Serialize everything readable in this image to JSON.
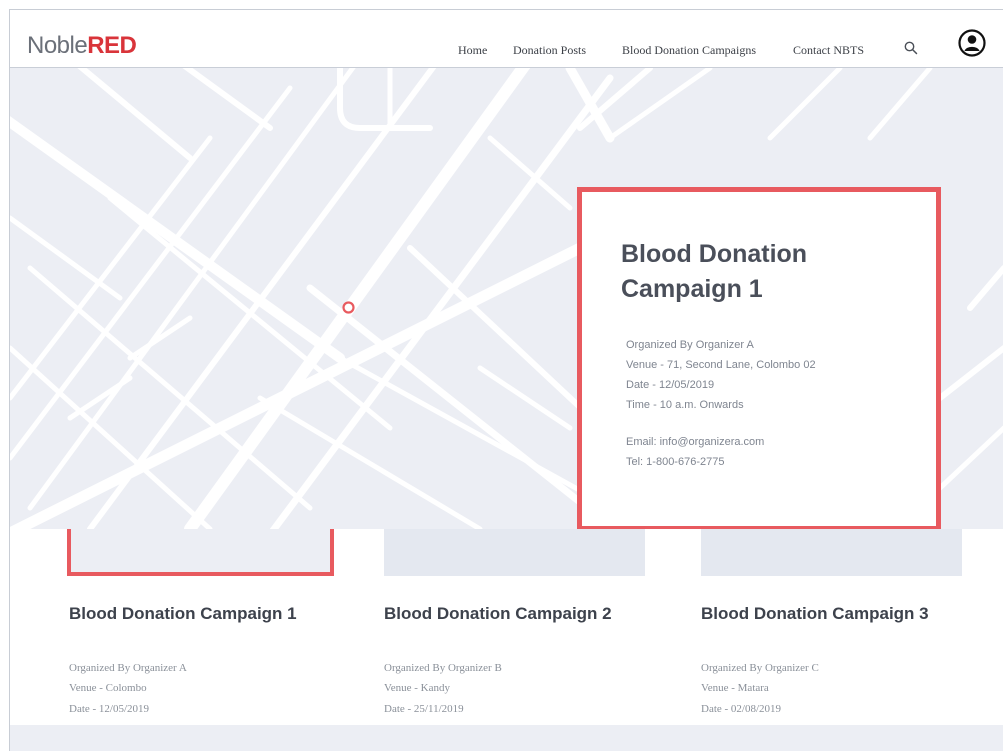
{
  "brand": {
    "prefix": "Noble",
    "suffix": "RED"
  },
  "nav": {
    "items": [
      {
        "label": "Home"
      },
      {
        "label": "Donation Posts"
      },
      {
        "label": "Blood Donation Campaigns"
      },
      {
        "label": "Contact NBTS"
      }
    ]
  },
  "icons": {
    "search": "search-icon",
    "profile": "user-profile-icon",
    "map_pin": "map-pin-icon"
  },
  "colors": {
    "accent": "#e85a5f",
    "brand_red": "#d9343a",
    "map_bg": "#eceef4",
    "road": "#ffffff"
  },
  "featured": {
    "title": "Blood Donation Campaign 1",
    "organizer": "Organized By Organizer A",
    "venue": "Venue - 71, Second Lane, Colombo 02",
    "date": "Date - 12/05/2019",
    "time": "Time - 10 a.m. Onwards",
    "email": "Email: info@organizera.com",
    "tel": "Tel: 1-800-676-2775"
  },
  "campaigns": [
    {
      "title": "Blood Donation Campaign 1",
      "organizer": "Organized By Organizer A",
      "venue": "Venue - Colombo",
      "date": "Date - 12/05/2019",
      "selected": true
    },
    {
      "title": "Blood Donation Campaign 2",
      "organizer": "Organized By Organizer B",
      "venue": "Venue - Kandy",
      "date": "Date - 25/11/2019",
      "selected": false
    },
    {
      "title": "Blood Donation Campaign 3",
      "organizer": "Organized By Organizer C",
      "venue": "Venue - Matara",
      "date": "Date - 02/08/2019",
      "selected": false
    }
  ]
}
